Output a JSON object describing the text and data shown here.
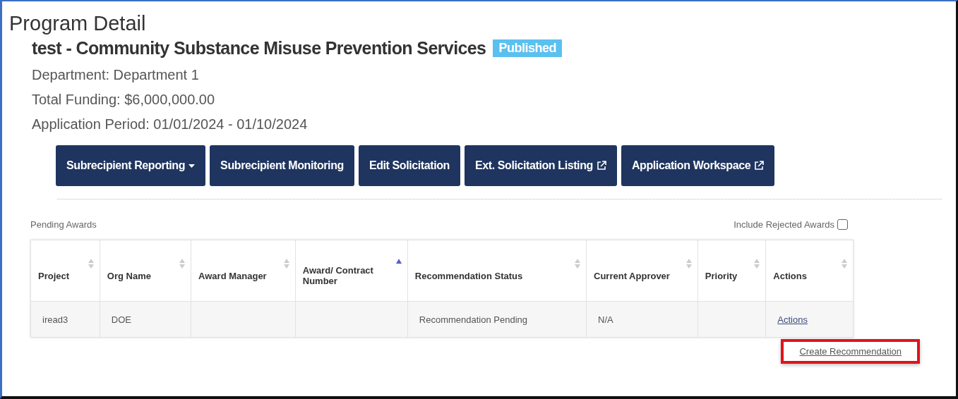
{
  "page_title": "Program Detail",
  "program": {
    "name": "test - Community Substance Misuse Prevention Services",
    "status": "Published",
    "details": [
      "Department: Department 1",
      "Total Funding: $6,000,000.00",
      "Application Period: 01/01/2024 - 01/10/2024"
    ]
  },
  "buttons": [
    {
      "label": "Subrecipient Reporting",
      "kind": "dropdown"
    },
    {
      "label": "Subrecipient Monitoring",
      "kind": "plain"
    },
    {
      "label": "Edit Solicitation",
      "kind": "plain"
    },
    {
      "label": "Ext. Solicitation Listing",
      "kind": "external"
    },
    {
      "label": "Application Workspace",
      "kind": "external"
    }
  ],
  "pending_awards": {
    "title": "Pending Awards",
    "include_rejected": {
      "label": "Include Rejected Awards",
      "checked": false
    },
    "columns": [
      {
        "label": "Project",
        "sorted": false
      },
      {
        "label": "Org Name",
        "sorted": false
      },
      {
        "label": "Award Manager",
        "sorted": false
      },
      {
        "label": "Award/ Contract Number",
        "sorted": true
      },
      {
        "label": "Recommendation Status",
        "sorted": false
      },
      {
        "label": "Current Approver",
        "sorted": false
      },
      {
        "label": "Priority",
        "sorted": false
      },
      {
        "label": "Actions",
        "sorted": false
      }
    ],
    "rows": [
      {
        "cells": [
          "iread3",
          "DOE",
          "",
          "",
          "Recommendation Pending",
          "N/A",
          ""
        ],
        "action": "Actions"
      }
    ],
    "menu": [
      {
        "label": "Create Recommendation",
        "highlighted": true
      }
    ]
  }
}
